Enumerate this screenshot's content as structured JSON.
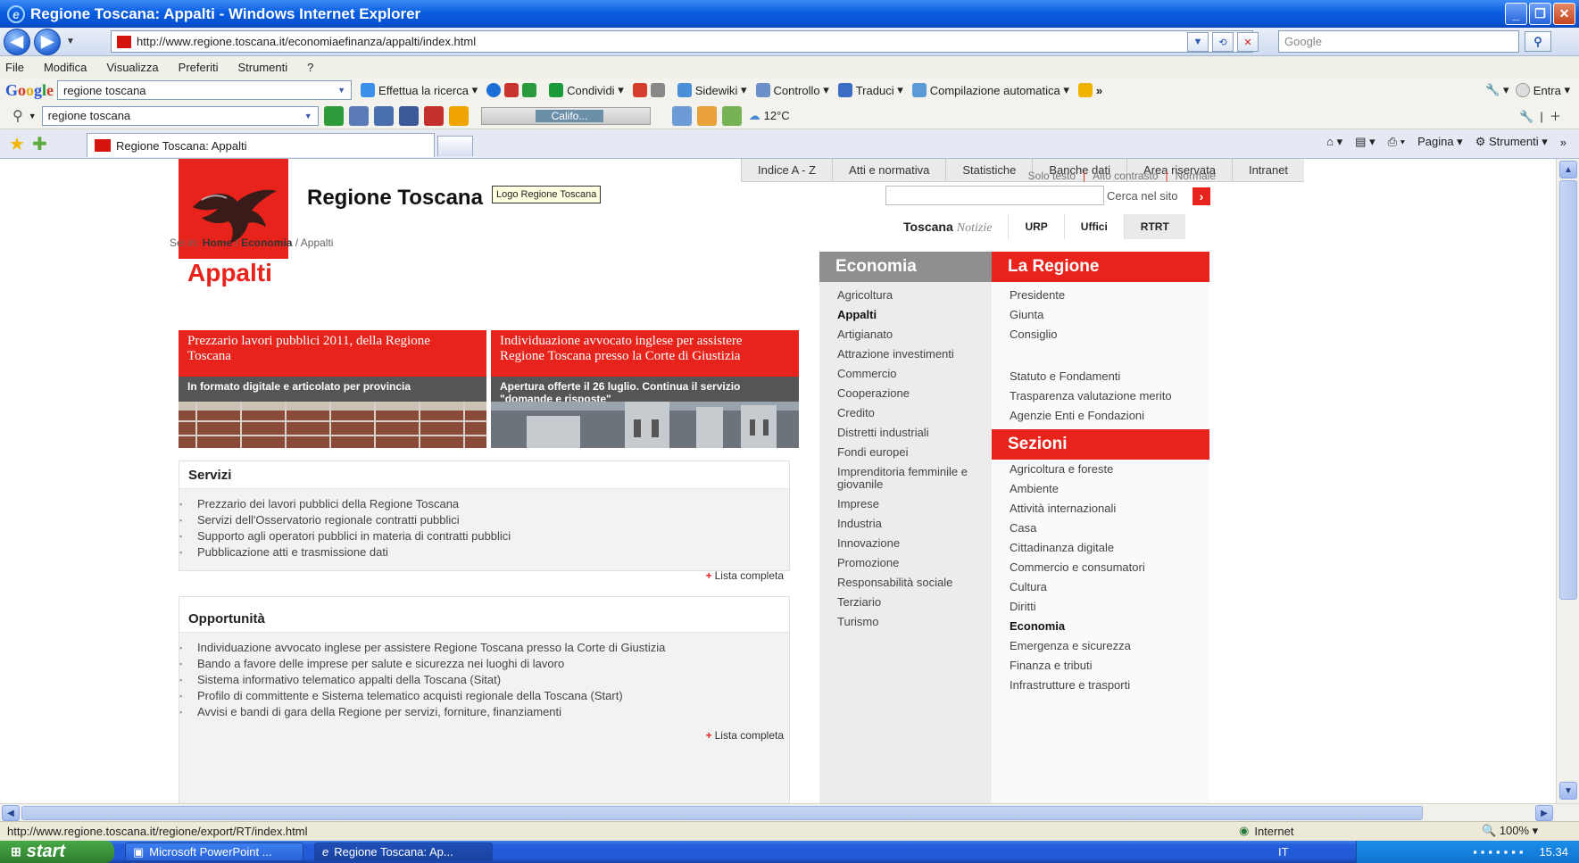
{
  "window": {
    "title": "Regione Toscana: Appalti - Windows Internet Explorer"
  },
  "addressbar": {
    "url": "http://www.regione.toscana.it/economiaefinanza/appalti/index.html",
    "search_placeholder": "Google"
  },
  "menubar": [
    "File",
    "Modifica",
    "Visualizza",
    "Preferiti",
    "Strumenti",
    "?"
  ],
  "googlebar": {
    "query": "regione toscana",
    "items": [
      "Effettua la ricerca",
      "Condividi",
      "Sidewiki",
      "Controllo",
      "Traduci",
      "Compilazione automatica",
      "Entra"
    ]
  },
  "secondbar": {
    "query": "regione toscana",
    "radio": "Califo...",
    "weather": "12°C"
  },
  "tabs": {
    "active": "Regione Toscana: Appalti",
    "commands": [
      "Pagina",
      "Strumenti"
    ]
  },
  "site": {
    "topnav": [
      "Indice A - Z",
      "Atti e normativa",
      "Statistiche",
      "Banche dati",
      "Area riservata",
      "Intranet"
    ],
    "title": "Regione Toscana",
    "tooltip": "Logo Regione Toscana",
    "access_links": [
      "Solo testo",
      "Alto contrasto",
      "Normale"
    ],
    "search_label": "Cerca nel sito",
    "service_tabs": {
      "toscana": "Toscana",
      "notizie": "Notizie",
      "urp": "URP",
      "uffici": "Uffici",
      "rtrt": "RTRT"
    },
    "breadcrumb": {
      "prefix": "Sei in:",
      "home": "Home",
      "economia": "Economia",
      "current": "Appalti"
    },
    "page_title": "Appalti",
    "promos": [
      {
        "title": "Prezzario lavori pubblici 2011, della Regione Toscana",
        "subtitle": "In formato digitale e articolato per provincia"
      },
      {
        "title": "Individuazione avvocato inglese per assistere Regione Toscana presso la Corte di Giustizia",
        "subtitle": "Apertura offerte il 26 luglio. Continua il servizio \"domande e risposte\""
      }
    ],
    "servizi": {
      "heading": "Servizi",
      "items": [
        "Prezzario dei lavori pubblici della Regione Toscana",
        "Servizi dell'Osservatorio regionale contratti pubblici",
        "Supporto agli operatori pubblici in materia di contratti pubblici",
        "Pubblicazione atti e trasmissione dati"
      ],
      "more": "Lista completa"
    },
    "opportunita": {
      "heading": "Opportunità",
      "items": [
        "Individuazione avvocato inglese per assistere Regione Toscana presso la Corte di Giustizia",
        "Bando a favore delle imprese per salute e sicurezza nei luoghi di lavoro",
        "Sistema informativo telematico appalti della Toscana (Sitat)",
        "Profilo di committente e Sistema telematico acquisti regionale della Toscana (Start)",
        "Avvisi e bandi di gara della Regione per servizi, forniture, finanziamenti"
      ],
      "more": "Lista completa"
    },
    "economia": {
      "heading": "Economia",
      "items": [
        "Agricoltura",
        "Appalti",
        "Artigianato",
        "Attrazione investimenti",
        "Commercio",
        "Cooperazione",
        "Credito",
        "Distretti industriali",
        "Fondi europei",
        "Imprenditoria femminile e giovanile",
        "Imprese",
        "Industria",
        "Innovazione",
        "Promozione",
        "Responsabilità sociale",
        "Terziario",
        "Turismo"
      ]
    },
    "regione": {
      "heading": "La Regione",
      "items_a": [
        "Presidente",
        "Giunta",
        "Consiglio"
      ],
      "items_b": [
        "Statuto e Fondamenti",
        "Trasparenza valutazione merito",
        "Agenzie Enti e Fondazioni"
      ]
    },
    "sezioni": {
      "heading": "Sezioni",
      "items": [
        "Agricoltura e foreste",
        "Ambiente",
        "Attività internazionali",
        "Casa",
        "Cittadinanza digitale",
        "Commercio e consumatori",
        "Cultura",
        "Diritti",
        "Economia",
        "Emergenza e sicurezza",
        "Finanza e tributi",
        "Infrastrutture e trasporti"
      ]
    }
  },
  "statusbar": {
    "url": "http://www.regione.toscana.it/regione/export/RT/index.html",
    "zone": "Internet",
    "zoom": "100%"
  },
  "taskbar": {
    "start": "start",
    "tasks": [
      "Microsoft PowerPoint ...",
      "Regione Toscana: Ap..."
    ],
    "lang": "IT",
    "clock": "15.34"
  },
  "colors": {
    "accent": "#e8231b",
    "xp_blue": "#0a5ee0"
  }
}
